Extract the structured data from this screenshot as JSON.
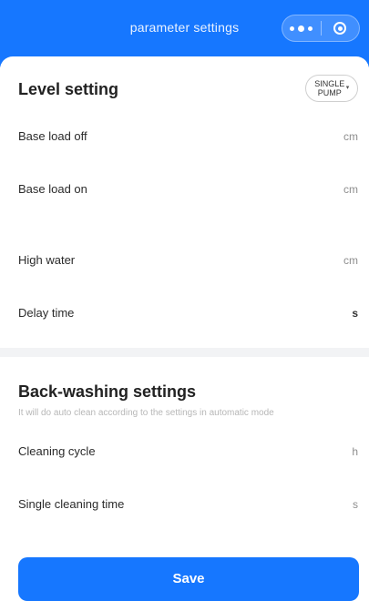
{
  "header": {
    "title": "parameter settings"
  },
  "level_setting": {
    "title": "Level setting",
    "mode_label": "SINGLE PUMP",
    "rows": [
      {
        "label": "Base load off",
        "unit": "cm"
      },
      {
        "label": "Base load on",
        "unit": "cm"
      },
      {
        "label": "High water",
        "unit": "cm"
      },
      {
        "label": "Delay time",
        "unit": "s"
      }
    ]
  },
  "backwash": {
    "title": "Back-washing settings",
    "description": "It will do auto clean according to the settings in automatic mode",
    "rows": [
      {
        "label": "Cleaning cycle",
        "unit": "h"
      },
      {
        "label": "Single cleaning time",
        "unit": "s"
      }
    ]
  },
  "save_label": "Save",
  "colors": {
    "primary": "#1677ff",
    "section_gap": "#f2f3f5"
  },
  "icons": [
    "more-dots-icon",
    "close-circle-icon",
    "caret-down-icon"
  ]
}
